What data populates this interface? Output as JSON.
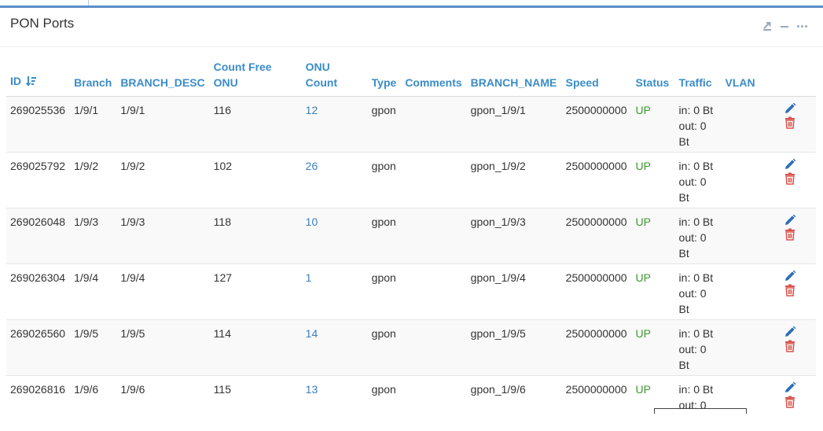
{
  "panel": {
    "title": "PON Ports"
  },
  "icons": {
    "export": "export-icon",
    "minimize": "minus-icon",
    "more": "more-icon",
    "sort": "sort-descending-icon",
    "edit": "pencil-icon",
    "delete": "trash-icon"
  },
  "colors": {
    "header_text": "#3a8cc8",
    "link": "#3a7fc0",
    "status_up": "#3c9a2e",
    "delete_icon": "#d9534f",
    "edit_icon": "#2a6fb5",
    "top_bar": "#5b8fc7"
  },
  "table": {
    "columns": {
      "id": "ID",
      "branch": "Branch",
      "branch_desc": "BRANCH_DESC",
      "count_free_onu": "Count Free ONU",
      "onu_count": "ONU Count",
      "type": "Type",
      "comments": "Comments",
      "branch_name": "BRANCH_NAME",
      "speed": "Speed",
      "status": "Status",
      "traffic": "Traffic",
      "vlan": "VLAN"
    },
    "rows": [
      {
        "id": "269025536",
        "branch": "1/9/1",
        "branch_desc": "1/9/1",
        "count_free_onu": "116",
        "onu_count": "12",
        "type": "gpon",
        "comments": "",
        "branch_name": "gpon_1/9/1",
        "speed": "2500000000",
        "status": "UP",
        "traffic_in": "in: 0 Bt",
        "traffic_out": "out: 0 Bt",
        "vlan": ""
      },
      {
        "id": "269025792",
        "branch": "1/9/2",
        "branch_desc": "1/9/2",
        "count_free_onu": "102",
        "onu_count": "26",
        "type": "gpon",
        "comments": "",
        "branch_name": "gpon_1/9/2",
        "speed": "2500000000",
        "status": "UP",
        "traffic_in": "in: 0 Bt",
        "traffic_out": "out: 0 Bt",
        "vlan": ""
      },
      {
        "id": "269026048",
        "branch": "1/9/3",
        "branch_desc": "1/9/3",
        "count_free_onu": "118",
        "onu_count": "10",
        "type": "gpon",
        "comments": "",
        "branch_name": "gpon_1/9/3",
        "speed": "2500000000",
        "status": "UP",
        "traffic_in": "in: 0 Bt",
        "traffic_out": "out: 0 Bt",
        "vlan": ""
      },
      {
        "id": "269026304",
        "branch": "1/9/4",
        "branch_desc": "1/9/4",
        "count_free_onu": "127",
        "onu_count": "1",
        "type": "gpon",
        "comments": "",
        "branch_name": "gpon_1/9/4",
        "speed": "2500000000",
        "status": "UP",
        "traffic_in": "in: 0 Bt",
        "traffic_out": "out: 0 Bt",
        "vlan": ""
      },
      {
        "id": "269026560",
        "branch": "1/9/5",
        "branch_desc": "1/9/5",
        "count_free_onu": "114",
        "onu_count": "14",
        "type": "gpon",
        "comments": "",
        "branch_name": "gpon_1/9/5",
        "speed": "2500000000",
        "status": "UP",
        "traffic_in": "in: 0 Bt",
        "traffic_out": "out: 0 Bt",
        "vlan": ""
      },
      {
        "id": "269026816",
        "branch": "1/9/6",
        "branch_desc": "1/9/6",
        "count_free_onu": "115",
        "onu_count": "13",
        "type": "gpon",
        "comments": "",
        "branch_name": "gpon_1/9/6",
        "speed": "2500000000",
        "status": "UP",
        "traffic_in": "in: 0 Bt",
        "traffic_out": "out: 0",
        "vlan": ""
      }
    ]
  }
}
